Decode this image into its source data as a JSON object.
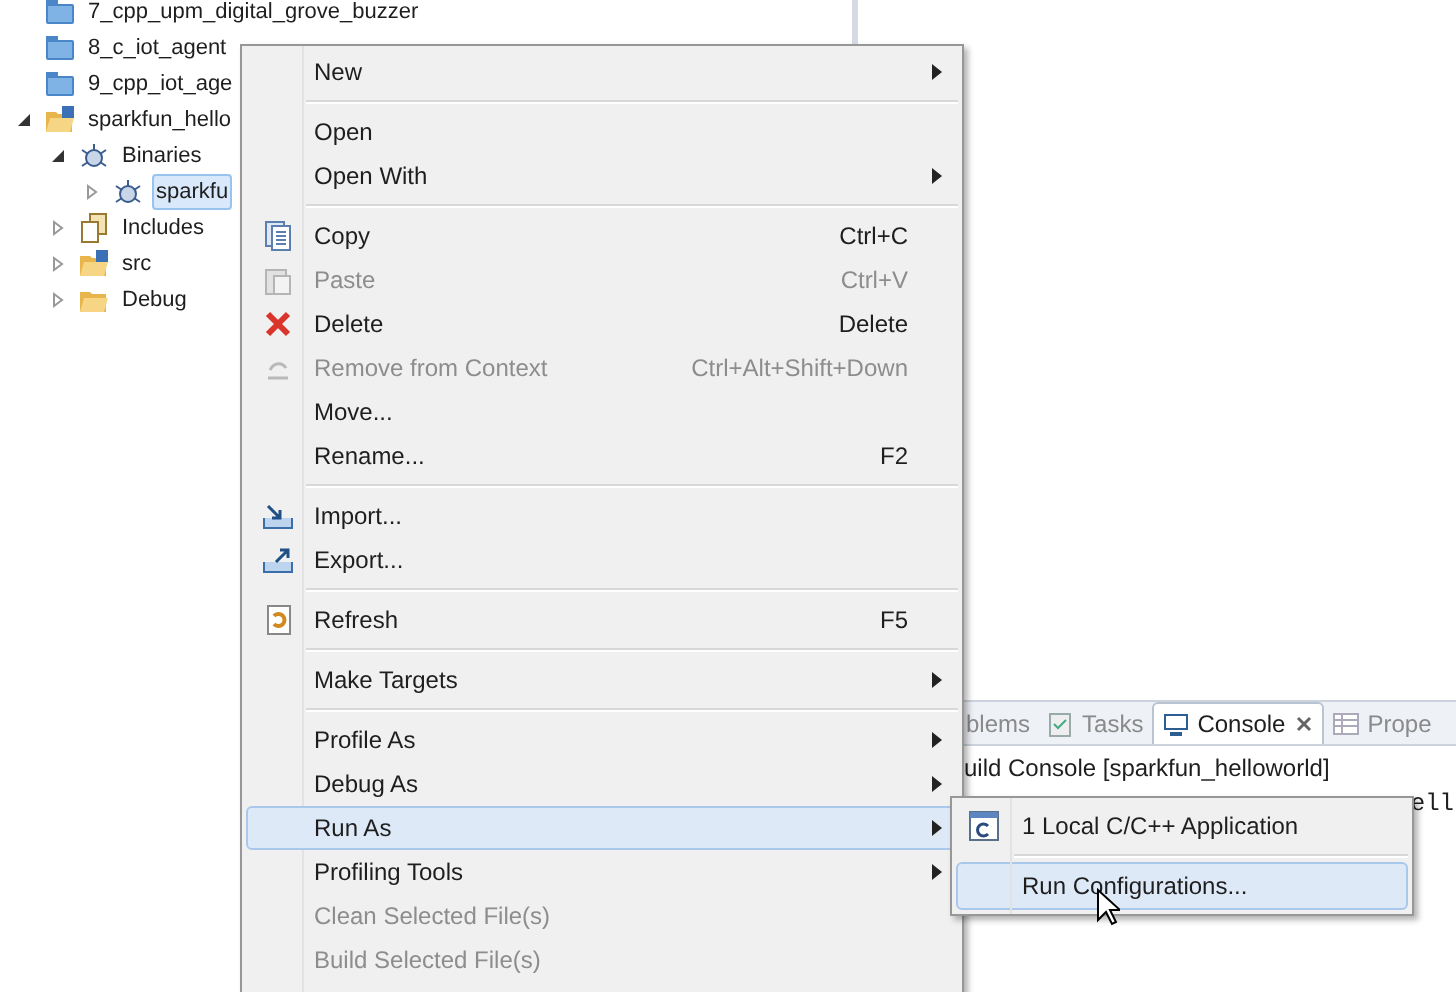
{
  "tree": [
    {
      "label": "7_cpp_upm_digital_grove_buzzer",
      "selected": false,
      "kind": "project"
    },
    {
      "label": "8_c_iot_agent",
      "selected": false,
      "kind": "project"
    },
    {
      "label": "9_cpp_iot_age",
      "selected": false,
      "kind": "project"
    },
    {
      "label": "sparkfun_hello",
      "expanded": true,
      "selected": false,
      "kind": "cproject",
      "children": [
        {
          "label": "Binaries",
          "expanded": true,
          "selected": false,
          "kind": "binaries",
          "children": [
            {
              "label": "sparkfu",
              "expanded": false,
              "selected": true,
              "kind": "binary"
            }
          ]
        },
        {
          "label": "Includes",
          "expanded": false,
          "selected": false,
          "kind": "includes"
        },
        {
          "label": "src",
          "expanded": false,
          "selected": false,
          "kind": "srcfolder"
        },
        {
          "label": "Debug",
          "expanded": false,
          "selected": false,
          "kind": "folder"
        }
      ]
    }
  ],
  "console": {
    "tabs": [
      {
        "label": "blems",
        "selected": false
      },
      {
        "label": "Tasks",
        "selected": false
      },
      {
        "label": "Console",
        "selected": true
      },
      {
        "label": "Prope",
        "selected": false
      }
    ],
    "lines": [
      "uild Console [sparkfun_helloworld]",
      "ell"
    ]
  },
  "context_menu": [
    {
      "kind": "item",
      "label": "New",
      "submenu": true,
      "disabled": false,
      "selected": false
    },
    {
      "kind": "separator"
    },
    {
      "kind": "item",
      "label": "Open",
      "submenu": false,
      "disabled": false,
      "selected": false
    },
    {
      "kind": "item",
      "label": "Open With",
      "submenu": true,
      "disabled": false,
      "selected": false
    },
    {
      "kind": "separator"
    },
    {
      "kind": "item",
      "label": "Copy",
      "shortcut": "Ctrl+C",
      "submenu": false,
      "disabled": false,
      "selected": false
    },
    {
      "kind": "item",
      "label": "Paste",
      "shortcut": "Ctrl+V",
      "submenu": false,
      "disabled": true,
      "selected": false
    },
    {
      "kind": "item",
      "label": "Delete",
      "shortcut": "Delete",
      "submenu": false,
      "disabled": false,
      "selected": false
    },
    {
      "kind": "item",
      "label": "Remove from Context",
      "shortcut": "Ctrl+Alt+Shift+Down",
      "submenu": false,
      "disabled": true,
      "selected": false
    },
    {
      "kind": "item",
      "label": "Move...",
      "submenu": false,
      "disabled": false,
      "selected": false
    },
    {
      "kind": "item",
      "label": "Rename...",
      "shortcut": "F2",
      "submenu": false,
      "disabled": false,
      "selected": false
    },
    {
      "kind": "separator"
    },
    {
      "kind": "item",
      "label": "Import...",
      "submenu": false,
      "disabled": false,
      "selected": false
    },
    {
      "kind": "item",
      "label": "Export...",
      "submenu": false,
      "disabled": false,
      "selected": false
    },
    {
      "kind": "separator"
    },
    {
      "kind": "item",
      "label": "Refresh",
      "shortcut": "F5",
      "submenu": false,
      "disabled": false,
      "selected": false
    },
    {
      "kind": "separator"
    },
    {
      "kind": "item",
      "label": "Make Targets",
      "submenu": true,
      "disabled": false,
      "selected": false
    },
    {
      "kind": "separator"
    },
    {
      "kind": "item",
      "label": "Profile As",
      "submenu": true,
      "disabled": false,
      "selected": false
    },
    {
      "kind": "item",
      "label": "Debug As",
      "submenu": true,
      "disabled": false,
      "selected": false
    },
    {
      "kind": "item",
      "label": "Run As",
      "submenu": true,
      "disabled": false,
      "selected": true
    },
    {
      "kind": "item",
      "label": "Profiling Tools",
      "submenu": true,
      "disabled": false,
      "selected": false
    },
    {
      "kind": "item",
      "label": "Clean Selected File(s)",
      "submenu": false,
      "disabled": true,
      "selected": false
    },
    {
      "kind": "item",
      "label": "Build Selected File(s)",
      "submenu": false,
      "disabled": true,
      "selected": false
    }
  ],
  "submenu": [
    {
      "label": "1 Local C/C++ Application",
      "selected": false,
      "has_icon": true
    },
    {
      "kind": "separator"
    },
    {
      "label": "Run Configurations...",
      "selected": true,
      "has_icon": false
    }
  ]
}
